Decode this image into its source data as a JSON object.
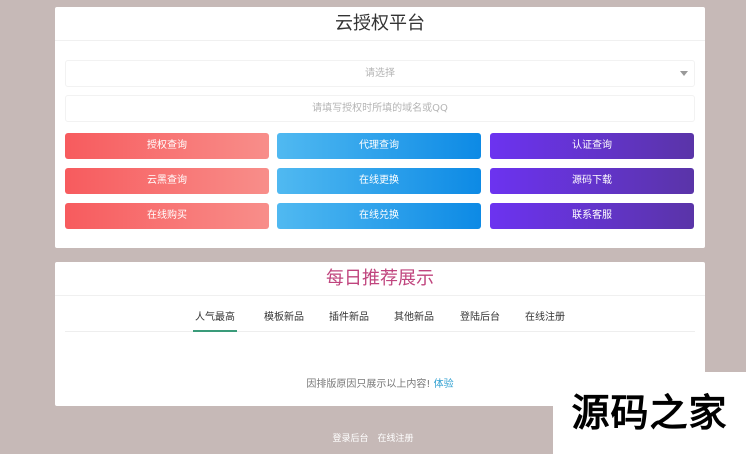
{
  "auth_panel": {
    "title": "云授权平台",
    "select_placeholder": "请选择",
    "domain_placeholder": "请填写授权时所填的域名或QQ",
    "buttons": {
      "auth_query": "授权查询",
      "agent_query": "代理查询",
      "cert_query": "认证查询",
      "blacklist_query": "云黑查询",
      "online_change": "在线更换",
      "source_download": "源码下载",
      "online_buy": "在线购买",
      "online_redeem": "在线兑换",
      "contact_service": "联系客服"
    },
    "colors": {
      "red": "#f75b5e",
      "blue": "#50b9f1",
      "purple": "#6c33f0"
    }
  },
  "recommend_panel": {
    "title": "每日推荐展示",
    "tabs": [
      "人气最高",
      "模板新品",
      "插件新品",
      "其他新品",
      "登陆后台",
      "在线注册"
    ],
    "active_tab": "人气最高",
    "notice_text": "因排版原因只展示以上内容!",
    "notice_link": "体验"
  },
  "footer": {
    "login_link": "登录后台",
    "register_link": "在线注册"
  },
  "watermark": {
    "text": "源码之家"
  }
}
